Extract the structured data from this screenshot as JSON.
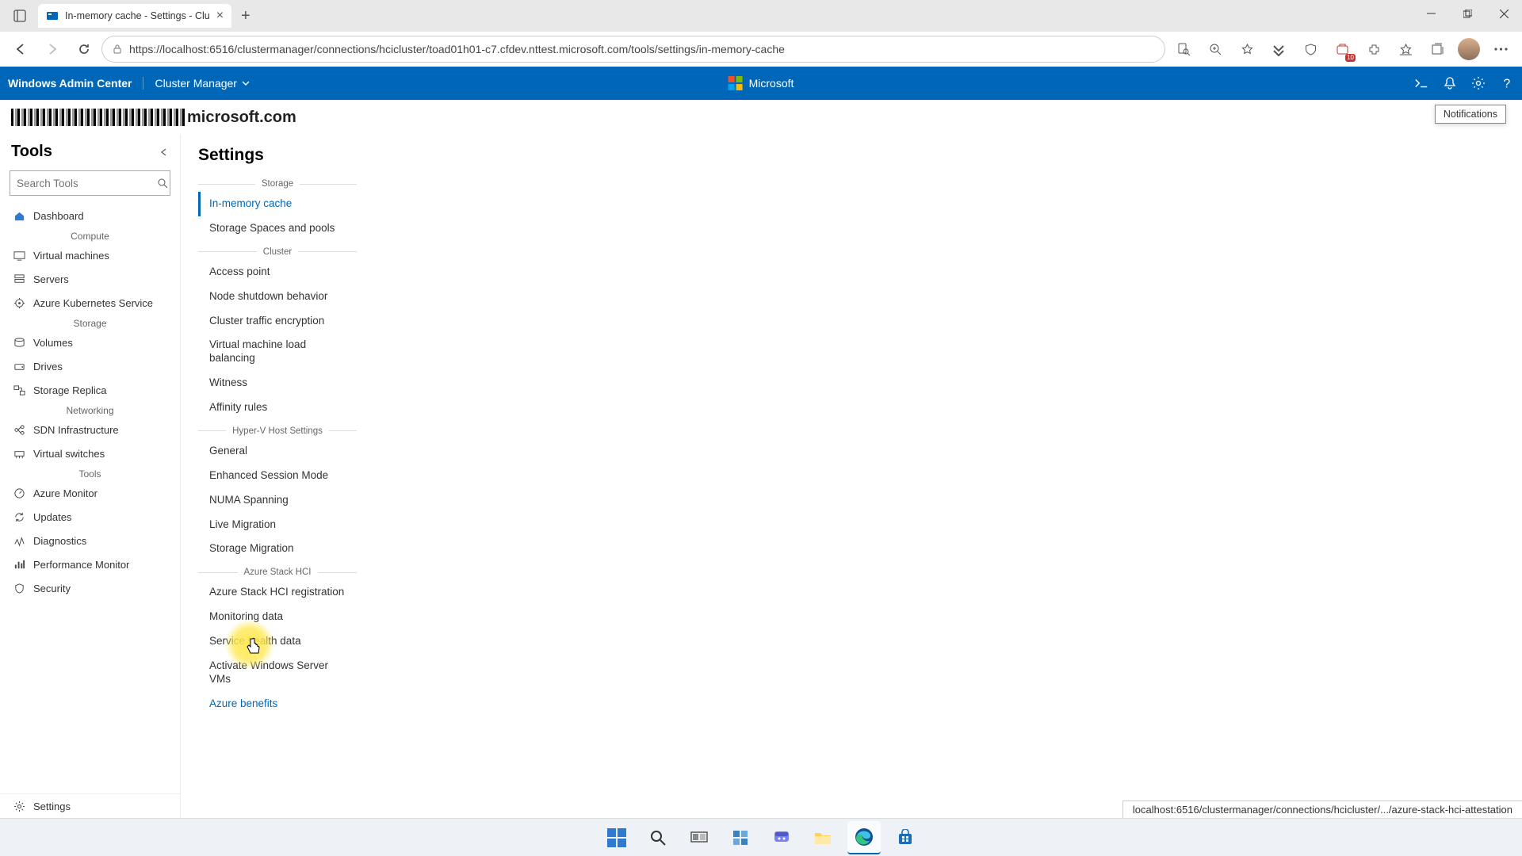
{
  "window": {
    "tab_title": "In-memory cache - Settings - Clu",
    "url": "https://localhost:6516/clustermanager/connections/hcicluster/toad01h01-c7.cfdev.nttest.microsoft.com/tools/settings/in-memory-cache",
    "collections_badge": "10"
  },
  "wac": {
    "brand": "Windows Admin Center",
    "scope": "Cluster Manager",
    "ms": "Microsoft",
    "notif_tooltip": "Notifications"
  },
  "cluster_name_suffix": "microsoft.com",
  "tools": {
    "title": "Tools",
    "search_placeholder": "Search Tools",
    "groups": [
      {
        "label": "",
        "items": [
          {
            "icon": "home",
            "label": "Dashboard"
          }
        ]
      },
      {
        "label": "Compute",
        "items": [
          {
            "icon": "vm",
            "label": "Virtual machines"
          },
          {
            "icon": "server",
            "label": "Servers"
          },
          {
            "icon": "aks",
            "label": "Azure Kubernetes Service"
          }
        ]
      },
      {
        "label": "Storage",
        "items": [
          {
            "icon": "volume",
            "label": "Volumes"
          },
          {
            "icon": "drive",
            "label": "Drives"
          },
          {
            "icon": "replica",
            "label": "Storage Replica"
          }
        ]
      },
      {
        "label": "Networking",
        "items": [
          {
            "icon": "sdn",
            "label": "SDN Infrastructure"
          },
          {
            "icon": "vswitch",
            "label": "Virtual switches"
          }
        ]
      },
      {
        "label": "Tools",
        "items": [
          {
            "icon": "monitor",
            "label": "Azure Monitor"
          },
          {
            "icon": "updates",
            "label": "Updates"
          },
          {
            "icon": "diag",
            "label": "Diagnostics"
          },
          {
            "icon": "perf",
            "label": "Performance Monitor"
          },
          {
            "icon": "security",
            "label": "Security"
          }
        ]
      }
    ],
    "settings_label": "Settings"
  },
  "settings": {
    "title": "Settings",
    "groups": [
      {
        "label": "Storage",
        "items": [
          {
            "label": "In-memory cache",
            "active": true
          },
          {
            "label": "Storage Spaces and pools"
          }
        ]
      },
      {
        "label": "Cluster",
        "items": [
          {
            "label": "Access point"
          },
          {
            "label": "Node shutdown behavior"
          },
          {
            "label": "Cluster traffic encryption"
          },
          {
            "label": "Virtual machine load balancing"
          },
          {
            "label": "Witness"
          },
          {
            "label": "Affinity rules"
          }
        ]
      },
      {
        "label": "Hyper-V Host Settings",
        "items": [
          {
            "label": "General"
          },
          {
            "label": "Enhanced Session Mode"
          },
          {
            "label": "NUMA Spanning"
          },
          {
            "label": "Live Migration"
          },
          {
            "label": "Storage Migration"
          }
        ]
      },
      {
        "label": "Azure Stack HCI",
        "items": [
          {
            "label": "Azure Stack HCI registration"
          },
          {
            "label": "Monitoring data"
          },
          {
            "label": "Service health data"
          },
          {
            "label": "Activate Windows Server VMs"
          },
          {
            "label": "Azure benefits",
            "hover": true
          }
        ]
      }
    ]
  },
  "status_url": "localhost:6516/clustermanager/connections/hcicluster/.../azure-stack-hci-attestation"
}
